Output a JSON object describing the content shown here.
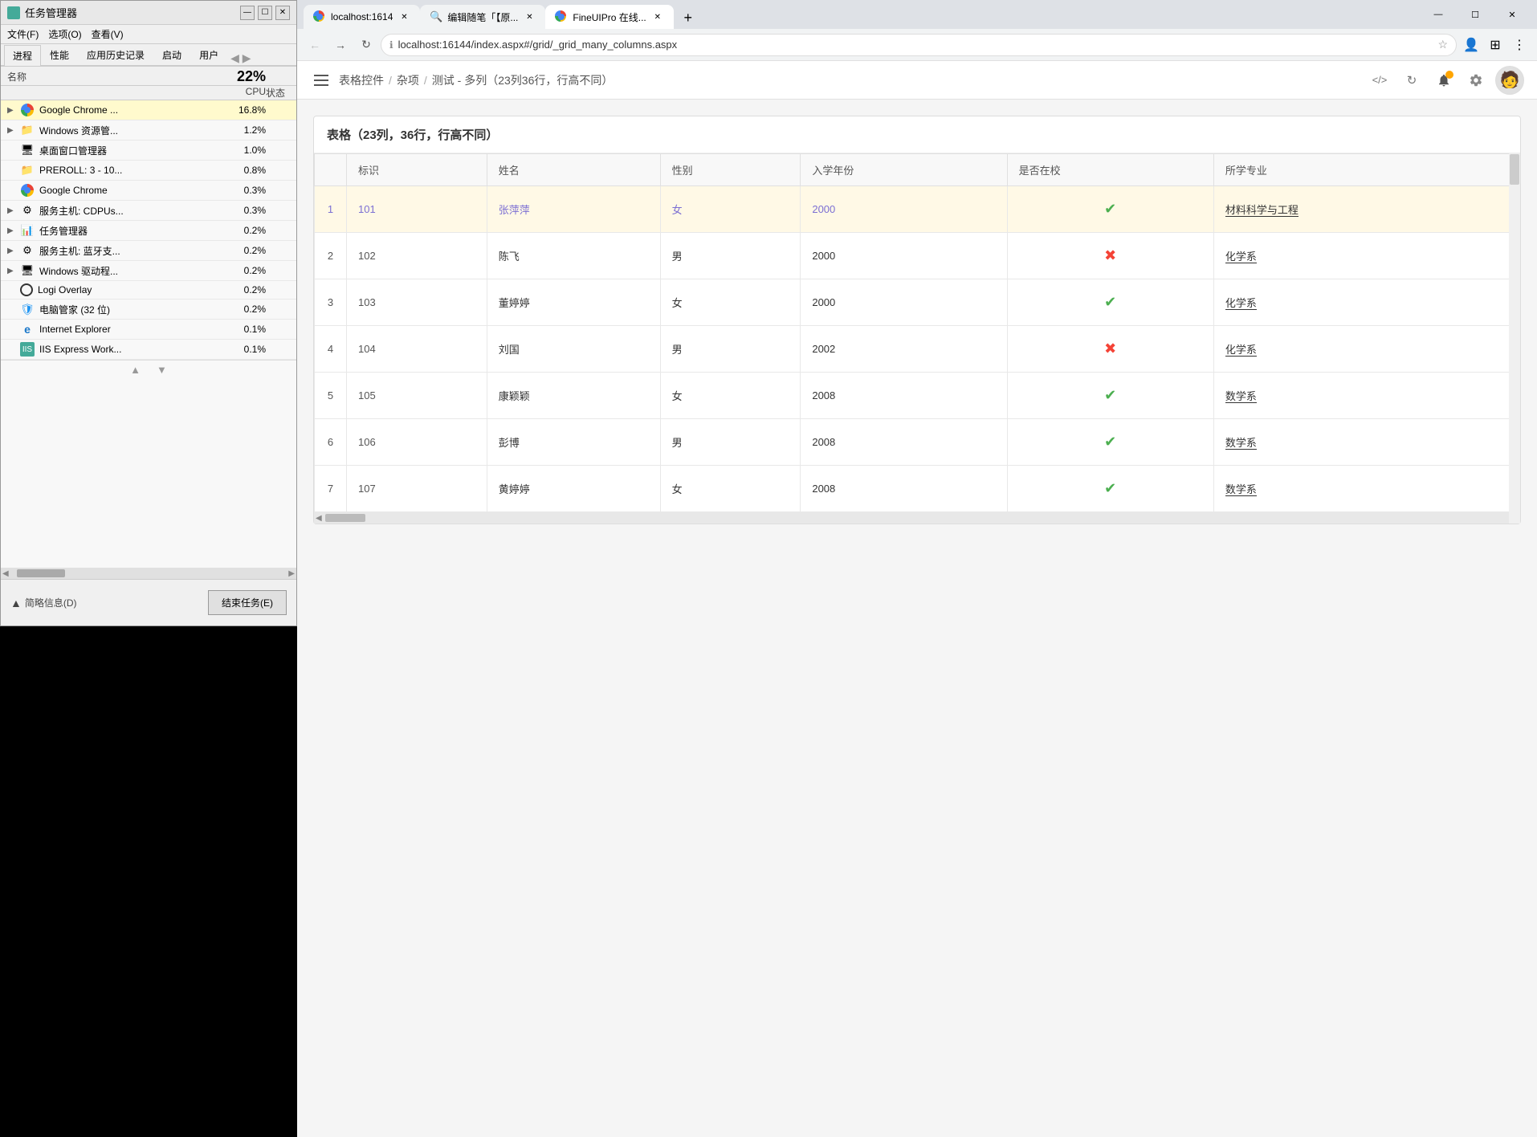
{
  "taskManager": {
    "title": "任务管理器",
    "menus": [
      "文件(F)",
      "选项(O)",
      "查看(V)"
    ],
    "tabs": [
      "进程",
      "性能",
      "应用历史记录",
      "启动",
      "用户"
    ],
    "cpuOverall": "22%",
    "colHeaders": {
      "name": "名称",
      "cpu": "CPU",
      "status": "状态"
    },
    "processes": [
      {
        "name": "Google Chrome ...",
        "cpu": "16.8%",
        "icon": "chrome",
        "expanded": true,
        "highlighted": true
      },
      {
        "name": "Windows 资源管...",
        "cpu": "1.2%",
        "icon": "folder",
        "expanded": true
      },
      {
        "name": "桌面窗口管理器",
        "cpu": "1.0%",
        "icon": "window"
      },
      {
        "name": "PREROLL: 3 - 10...",
        "cpu": "0.8%",
        "icon": "folder"
      },
      {
        "name": "Google Chrome",
        "cpu": "0.3%",
        "icon": "chrome"
      },
      {
        "name": "服务主机: CDPUs...",
        "cpu": "0.3%",
        "icon": "gear",
        "expanded": true
      },
      {
        "name": "任务管理器",
        "cpu": "0.2%",
        "icon": "task",
        "expanded": true
      },
      {
        "name": "服务主机: 蓝牙支...",
        "cpu": "0.2%",
        "icon": "gear",
        "expanded": true
      },
      {
        "name": "Windows 驱动程...",
        "cpu": "0.2%",
        "icon": "window",
        "expanded": true
      },
      {
        "name": "Logi Overlay",
        "cpu": "0.2%",
        "icon": "logi"
      },
      {
        "name": "电脑管家 (32 位)",
        "cpu": "0.2%",
        "icon": "shield"
      },
      {
        "name": "Internet Explorer",
        "cpu": "0.1%",
        "icon": "ie"
      },
      {
        "name": "IIS Express Work...",
        "cpu": "0.1%",
        "icon": "iis"
      }
    ],
    "bottomSummary": "简略信息(D)",
    "endTaskBtn": "结束任务(E)"
  },
  "chrome": {
    "tabs": [
      {
        "title": "localhost:1614",
        "active": false
      },
      {
        "title": "编辑随笔「【原...",
        "active": false
      },
      {
        "title": "FineUIPro 在线...",
        "active": true
      }
    ],
    "addressBar": "localhost:16144/index.aspx#/grid/_grid_many_columns.aspx",
    "breadcrumb": [
      "表格控件",
      "杂项",
      "测试 - 多列（23列36行，行高不同）"
    ],
    "tableTitle": "表格（23列，36行，行高不同）",
    "tableHeaders": [
      "标识",
      "姓名",
      "性别",
      "入学年份",
      "是否在校",
      "所学专业"
    ],
    "tableRows": [
      {
        "num": 1,
        "id": "101",
        "name": "张萍萍",
        "gender": "女",
        "year": "2000",
        "enrolled": true,
        "dept": "材料科学与工程",
        "selected": true
      },
      {
        "num": 2,
        "id": "102",
        "name": "陈飞",
        "gender": "男",
        "year": "2000",
        "enrolled": false,
        "dept": "化学系",
        "selected": false
      },
      {
        "num": 3,
        "id": "103",
        "name": "董婷婷",
        "gender": "女",
        "year": "2000",
        "enrolled": true,
        "dept": "化学系",
        "selected": false
      },
      {
        "num": 4,
        "id": "104",
        "name": "刘国",
        "gender": "男",
        "year": "2002",
        "enrolled": false,
        "dept": "化学系",
        "selected": false
      },
      {
        "num": 5,
        "id": "105",
        "name": "康颖颖",
        "gender": "女",
        "year": "2008",
        "enrolled": true,
        "dept": "数学系",
        "selected": false
      },
      {
        "num": 6,
        "id": "106",
        "name": "彭博",
        "gender": "男",
        "year": "2008",
        "enrolled": true,
        "dept": "数学系",
        "selected": false
      },
      {
        "num": 7,
        "id": "107",
        "name": "黄婷婷",
        "gender": "女",
        "year": "2008",
        "enrolled": true,
        "dept": "数学系",
        "selected": false
      }
    ]
  }
}
